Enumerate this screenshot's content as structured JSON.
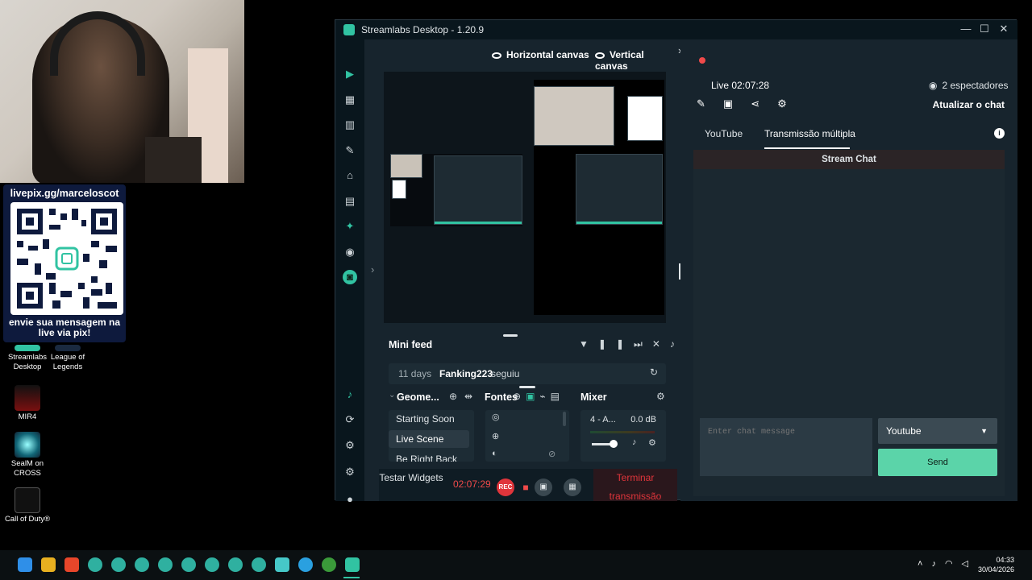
{
  "overlay": {
    "pix_url": "livepix.gg/marceloscot",
    "pix_message": "envie sua mensagem na live via pix!"
  },
  "desktop_icons": [
    {
      "label": "Streamlabs Desktop"
    },
    {
      "label": "League of Legends"
    },
    {
      "label": "MIR4"
    },
    {
      "label": "SealM on CROSS"
    },
    {
      "label": "Call of Duty®"
    }
  ],
  "window": {
    "title": "Streamlabs Desktop - 1.20.9",
    "controls": {
      "minimize": "—",
      "maximize": "☐",
      "close": "✕"
    }
  },
  "editor": {
    "horizontal_canvas": "Horizontal canvas",
    "vertical_canvas": "Vertical canvas",
    "minifeed_title": "Mini feed",
    "feed": {
      "time": "11 days",
      "user": "Fanking223",
      "action": "seguiu"
    },
    "scenes_title": "Geome...",
    "sources_title": "Fontes",
    "mixer_title": "Mixer",
    "scenes": [
      "Starting Soon",
      "Live Scene",
      "Be Right Back"
    ],
    "mixer": {
      "channel": "4 - A...",
      "level": "0.0 dB"
    },
    "footer": {
      "test_widgets": "Testar Widgets",
      "timer": "02:07:29",
      "rec": "REC",
      "end_stream": "Terminar transmissão"
    }
  },
  "chat": {
    "live_label": "Live 02:07:28",
    "viewers": "2 espectadores",
    "refresh": "Atualizar o chat",
    "tabs": [
      "YouTube",
      "Transmissão múltipla"
    ],
    "active_tab": "Transmissão múltipla",
    "stream_chat": "Stream Chat",
    "input_placeholder": "Enter chat message",
    "platform": "Youtube",
    "send": "Send"
  },
  "taskbar": {
    "time": "04:33",
    "date": "30/04/2026"
  },
  "colors": {
    "accent": "#31c3a2",
    "live_red": "#f04a4a",
    "end_stream": "#e0353b",
    "send": "#5bd4a9"
  }
}
